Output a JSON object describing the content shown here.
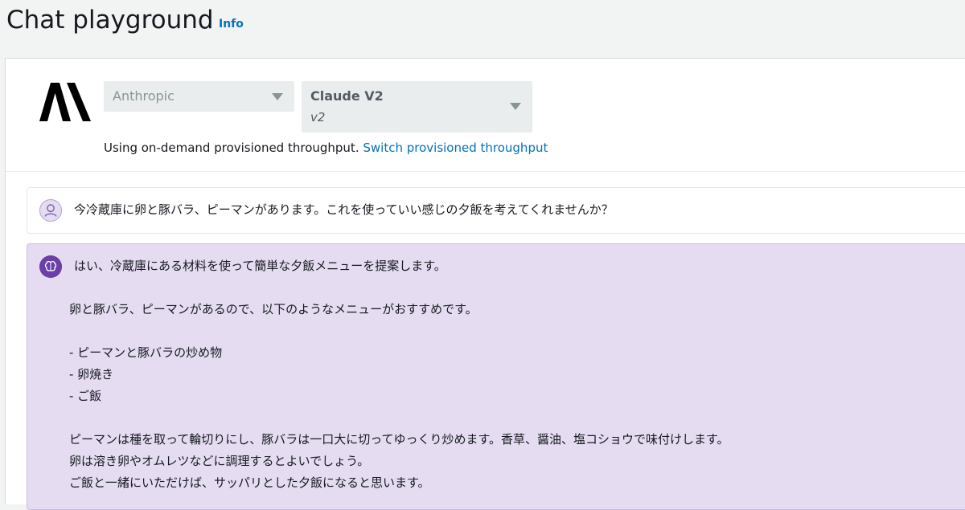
{
  "header": {
    "title": "Chat playground",
    "info_label": "Info"
  },
  "config": {
    "provider_value": "Anthropic",
    "model_value": "Claude V2",
    "model_version": "v2",
    "throughput_text": "Using on-demand provisioned throughput.",
    "throughput_link": "Switch provisioned throughput"
  },
  "icons": {
    "provider_logo": "anthropic-logo",
    "user_avatar": "user-icon",
    "bot_avatar": "brain-icon",
    "dropdown": "caret-down-icon"
  },
  "colors": {
    "link": "#0073bb",
    "bot_bubble": "#e5dcf2",
    "bot_avatar": "#6b3fa8"
  },
  "conversation": {
    "user_message": "今冷蔵庫に卵と豚バラ、ピーマンがあります。これを使っていい感じの夕飯を考えてくれませんか？",
    "bot_lines": [
      "はい、冷蔵庫にある材料を使って簡単な夕飯メニューを提案します。",
      "",
      "卵と豚バラ、ピーマンがあるので、以下のようなメニューがおすすめです。",
      "",
      "- ピーマンと豚バラの炒め物",
      "- 卵焼き",
      "- ご飯",
      "",
      "ピーマンは種を取って輪切りにし、豚バラは一口大に切ってゆっくり炒めます。香草、醤油、塩コショウで味付けします。",
      "卵は溶き卵やオムレツなどに調理するとよいでしょう。",
      "ご飯と一緒にいただけば、サッパリとした夕飯になると思います。"
    ]
  }
}
